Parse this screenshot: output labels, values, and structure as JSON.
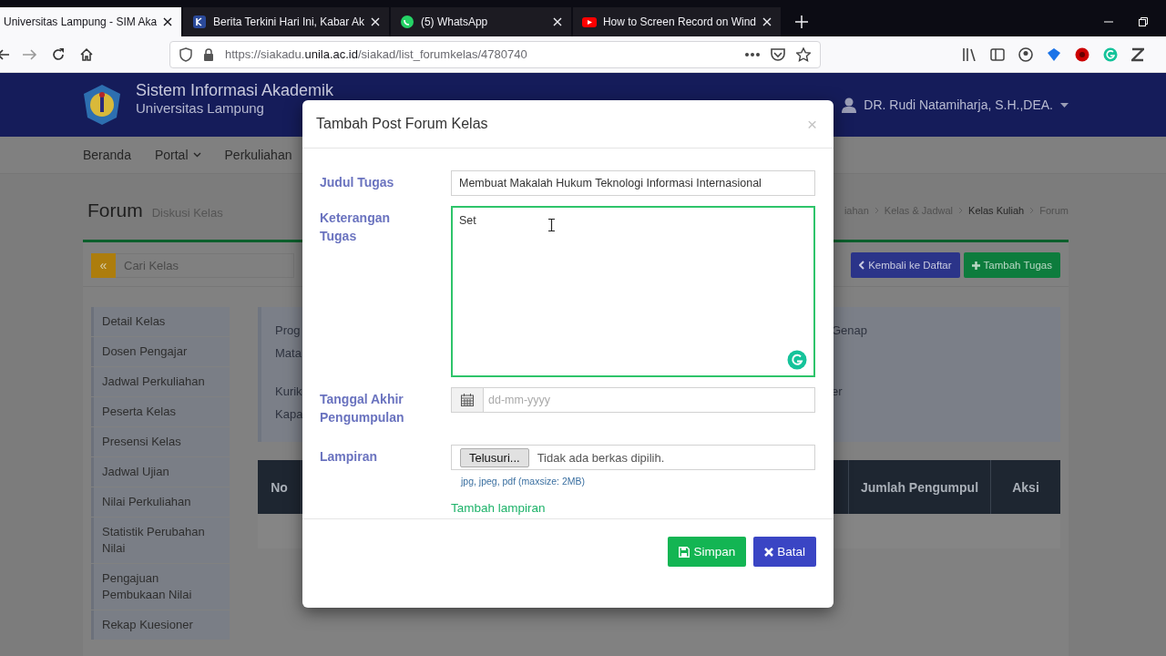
{
  "browser": {
    "tabs": [
      {
        "title": "Universitas Lampung - SIM Aka",
        "selected": true
      },
      {
        "title": "Berita Terkini Hari Ini, Kabar Ak",
        "selected": false
      },
      {
        "title": "(5) WhatsApp",
        "selected": false
      },
      {
        "title": "How to Screen Record on Wind",
        "selected": false
      }
    ],
    "url": "https://siakadu.**unila.ac.id**/siakad/list_forumkelas/4780740"
  },
  "site": {
    "title": "Sistem Informasi Akademik",
    "subtitle": "Universitas Lampung",
    "user": "DR. Rudi Natamiharja, S.H.,DEA."
  },
  "nav": [
    {
      "label": "Beranda",
      "dropdown": false
    },
    {
      "label": "Portal",
      "dropdown": true
    },
    {
      "label": "Perkuliahan",
      "dropdown": false
    }
  ],
  "page_heading": {
    "title": "Forum",
    "subtitle": "Diskusi Kelas"
  },
  "breadcrumb": [
    {
      "label": "iahan",
      "current": false
    },
    {
      "label": "Kelas & Jadwal",
      "current": false
    },
    {
      "label": "Kelas Kuliah",
      "current": true
    },
    {
      "label": "Forum",
      "current": false
    }
  ],
  "search": {
    "button": "«",
    "placeholder": "Cari Kelas"
  },
  "actions": [
    {
      "label": "Kembali ke Daftar",
      "kind": "back"
    },
    {
      "label": "Tambah Tugas",
      "kind": "add"
    }
  ],
  "sidebar": {
    "items": [
      "Detail Kelas",
      "Dosen Pengajar",
      "Jadwal Perkuliahan",
      "Peserta Kelas",
      "Presensi Kelas",
      "Jadwal Ujian",
      "Nilai Perkuliahan",
      "Statistik Perubahan Nilai",
      "Pengajuan Pembukaan Nilai",
      "Rekap Kuesioner"
    ]
  },
  "info": {
    "rows": [
      {
        "label": "Prog",
        "value": "Genap"
      },
      {
        "label": "Mata"
      },
      {
        "label": "Kurik",
        "value": "er"
      },
      {
        "label": "Kapa"
      }
    ]
  },
  "table": {
    "columns": [
      "No",
      "Jumlah Pengumpul",
      "Aksi"
    ]
  },
  "modal": {
    "title": "Tambah Post Forum Kelas",
    "close": "×",
    "fields": [
      {
        "kind": "text",
        "label": "Judul Tugas",
        "value": "Membuat Makalah Hukum Teknologi Informasi Internasional"
      },
      {
        "kind": "textarea",
        "label": "Keterangan Tugas",
        "value": "Set",
        "focused": true
      },
      {
        "kind": "date",
        "label": "Tanggal Akhir Pengumpulan",
        "placeholder": "dd-mm-yyyy"
      },
      {
        "kind": "file",
        "label": "Lampiran",
        "button": "Telusuri...",
        "status": "Tidak ada berkas dipilih.",
        "hint": "jpg, jpeg, pdf (maxsize: 2MB)"
      }
    ],
    "add_link": "Tambah lampiran",
    "buttons": [
      {
        "label": "Simpan",
        "kind": "save"
      },
      {
        "label": "Batal",
        "kind": "cancel"
      }
    ]
  }
}
